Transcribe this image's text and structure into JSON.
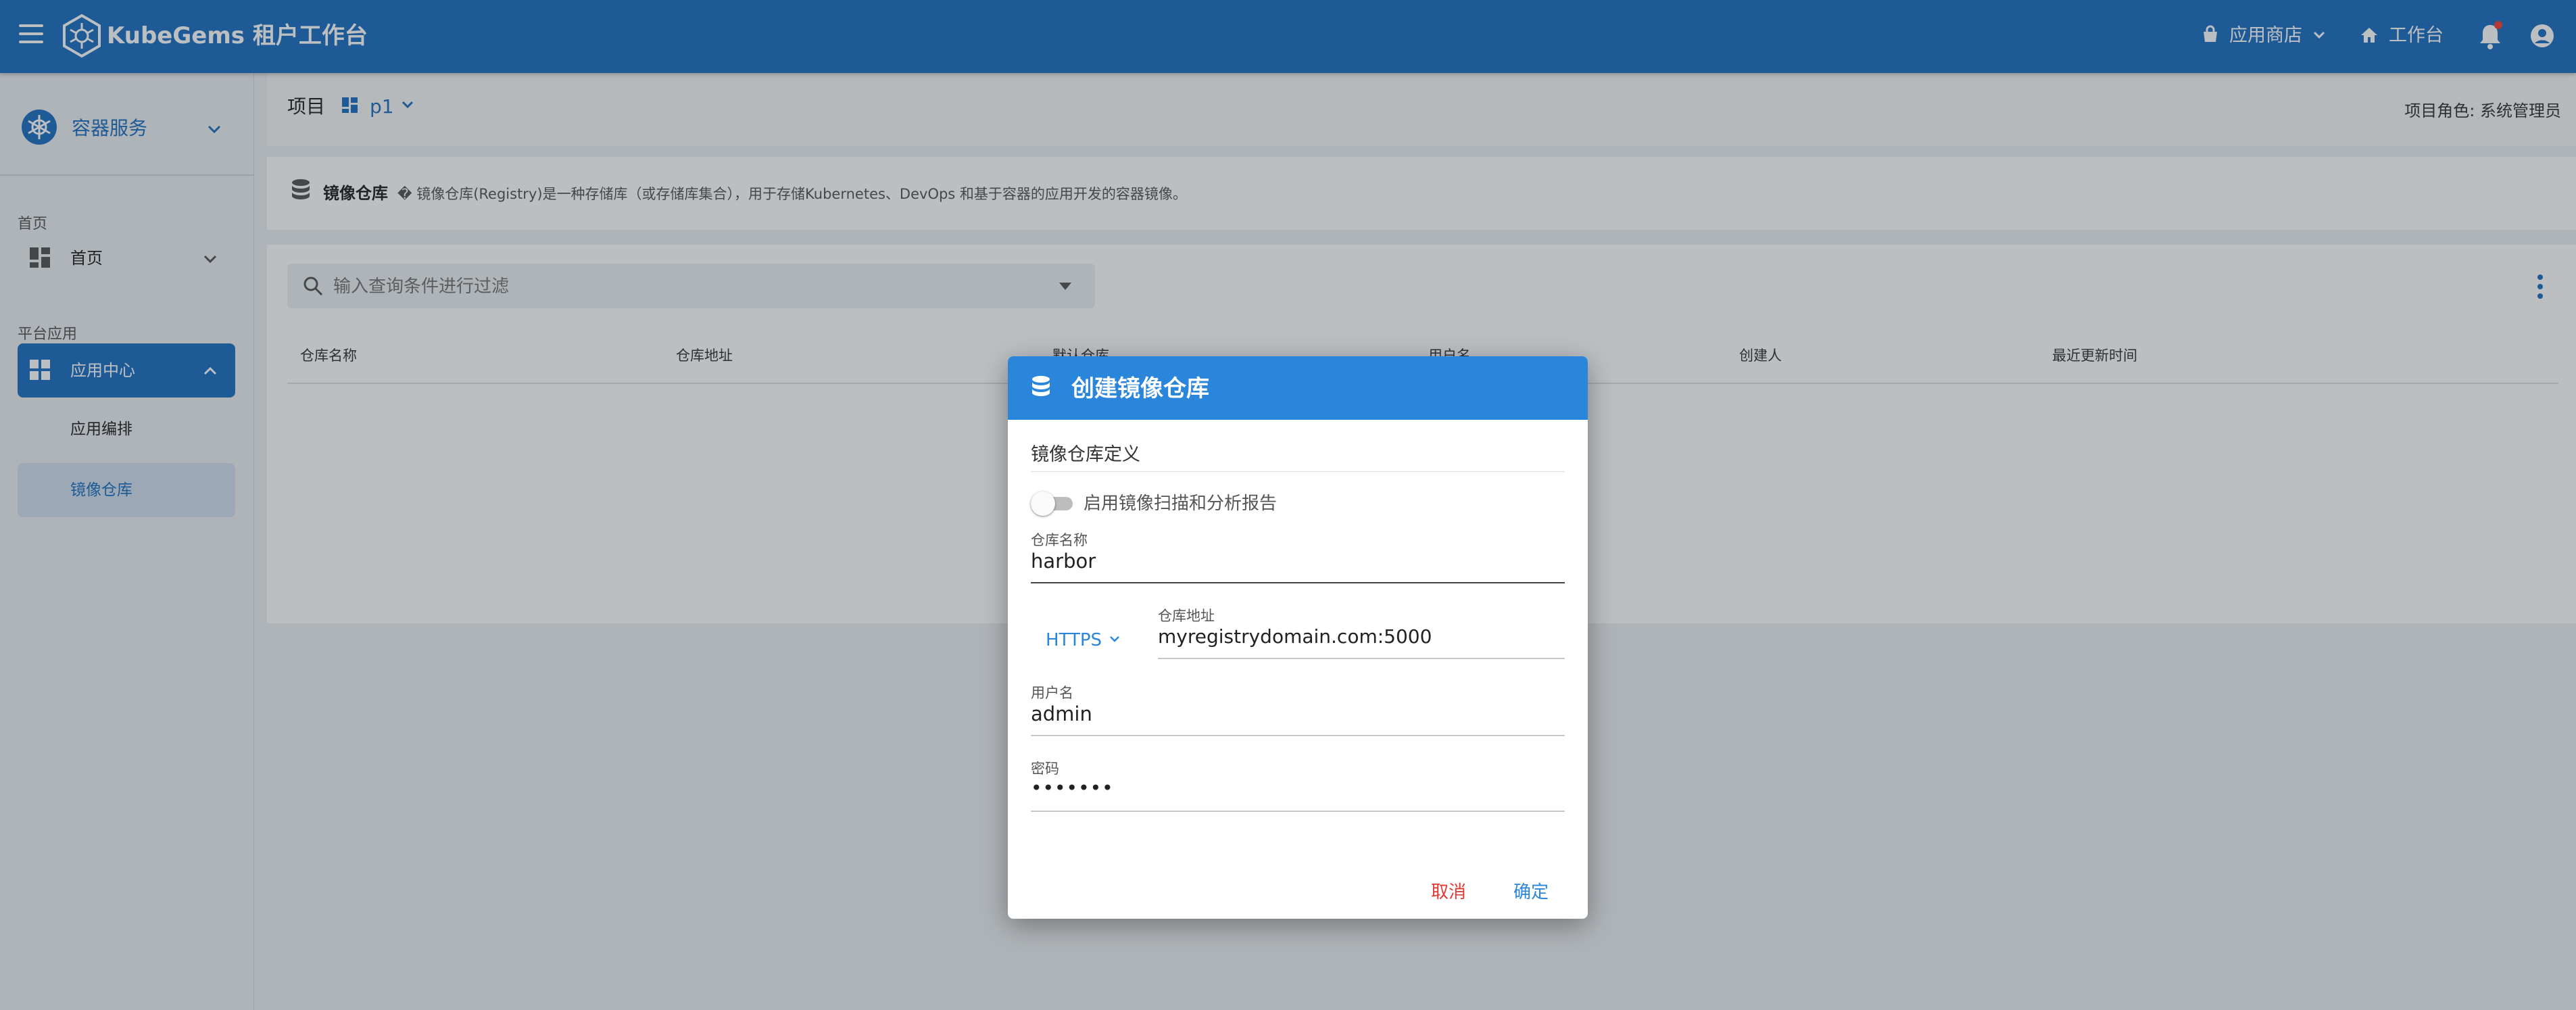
{
  "topbar": {
    "brand": "KubeGems 租户工作台",
    "app_store": "应用商店",
    "workbench": "工作台"
  },
  "sidebar": {
    "service": "容器服务",
    "section_home": "首页",
    "home": "首页",
    "section_platform": "平台应用",
    "app_center": "应用中心",
    "sub_items": [
      "应用编排",
      "镜像仓库"
    ]
  },
  "header": {
    "project_label": "项目",
    "project_name": "p1",
    "role": "项目角色: 系统管理员"
  },
  "registry": {
    "title": "镜像仓库",
    "description": "� 镜像仓库(Registry)是一种存储库（或存储库集合），用于存储Kubernetes、DevOps 和基于容器的应用开发的容器镜像。"
  },
  "list": {
    "search_placeholder": "输入查询条件进行过滤",
    "columns": [
      "仓库名称",
      "仓库地址",
      "默认仓库",
      "用户名",
      "创建人",
      "最近更新时间"
    ]
  },
  "dialog": {
    "title": "创建镜像仓库",
    "section": "镜像仓库定义",
    "scan_label": "启用镜像扫描和分析报告",
    "scan_enabled": false,
    "name_label": "仓库名称",
    "name_value": "harbor",
    "protocol": "HTTPS",
    "address_label": "仓库地址",
    "address_value": "myregistrydomain.com:5000",
    "user_label": "用户名",
    "user_value": "admin",
    "password_label": "密码",
    "password_value": "•••••••",
    "cancel": "取消",
    "confirm": "确定"
  },
  "colors": {
    "primary": "#1e6fbf",
    "dialog_header": "#2a86db",
    "cancel": "#e53935",
    "badge": "#f44336"
  }
}
